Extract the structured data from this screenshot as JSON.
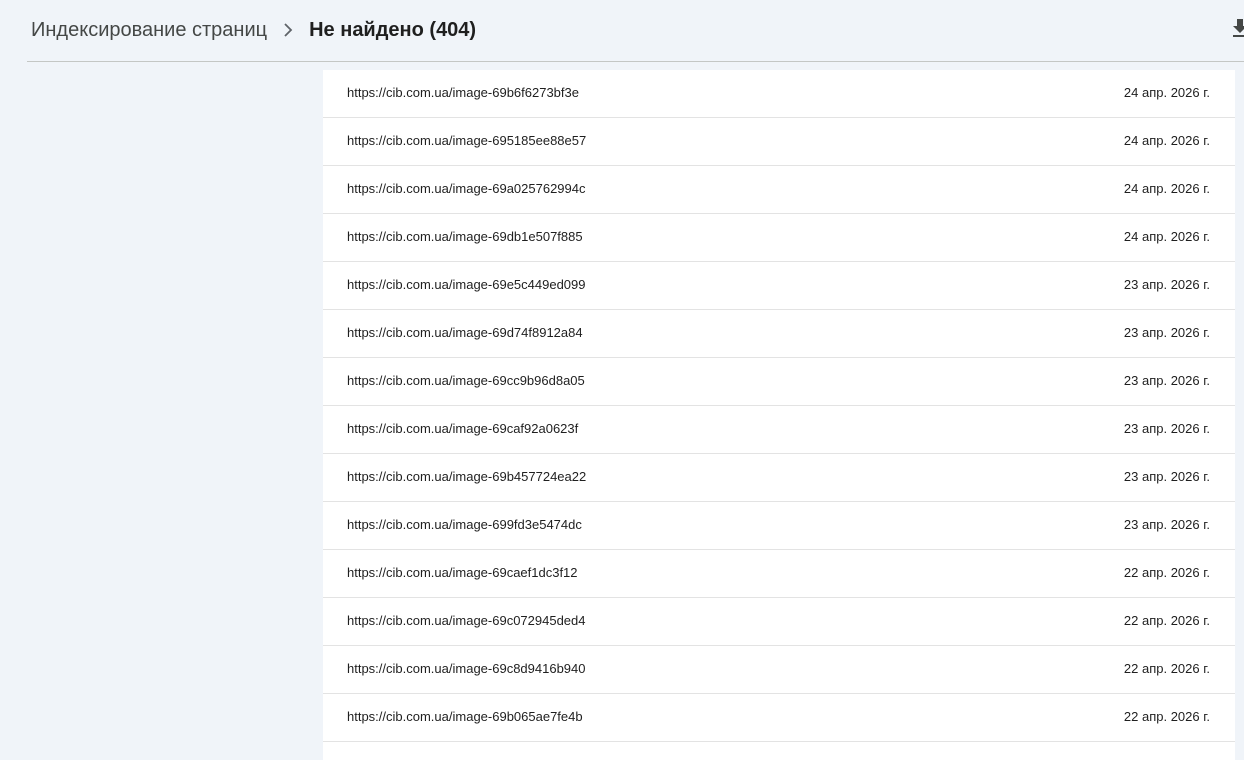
{
  "header": {
    "breadcrumb_parent": "Индексирование страниц",
    "breadcrumb_current": "Не найдено (404)"
  },
  "icons": {
    "separator": "chevron-right-icon",
    "download": "download-icon"
  },
  "colors": {
    "background": "#f0f4f9",
    "table_background": "#ffffff",
    "divider": "#c4c7c5",
    "text": "#1f1f1f"
  },
  "table": {
    "rows": [
      {
        "url": "https://cib.com.ua/image-69b6f6273bf3e",
        "date": "24 апр. 2026 г."
      },
      {
        "url": "https://cib.com.ua/image-695185ee88e57",
        "date": "24 апр. 2026 г."
      },
      {
        "url": "https://cib.com.ua/image-69a025762994c",
        "date": "24 апр. 2026 г."
      },
      {
        "url": "https://cib.com.ua/image-69db1e507f885",
        "date": "24 апр. 2026 г."
      },
      {
        "url": "https://cib.com.ua/image-69e5c449ed099",
        "date": "23 апр. 2026 г."
      },
      {
        "url": "https://cib.com.ua/image-69d74f8912a84",
        "date": "23 апр. 2026 г."
      },
      {
        "url": "https://cib.com.ua/image-69cc9b96d8a05",
        "date": "23 апр. 2026 г."
      },
      {
        "url": "https://cib.com.ua/image-69caf92a0623f",
        "date": "23 апр. 2026 г."
      },
      {
        "url": "https://cib.com.ua/image-69b457724ea22",
        "date": "23 апр. 2026 г."
      },
      {
        "url": "https://cib.com.ua/image-699fd3e5474dc",
        "date": "23 апр. 2026 г."
      },
      {
        "url": "https://cib.com.ua/image-69caef1dc3f12",
        "date": "22 апр. 2026 г."
      },
      {
        "url": "https://cib.com.ua/image-69c072945ded4",
        "date": "22 апр. 2026 г."
      },
      {
        "url": "https://cib.com.ua/image-69c8d9416b940",
        "date": "22 апр. 2026 г."
      },
      {
        "url": "https://cib.com.ua/image-69b065ae7fe4b",
        "date": "22 апр. 2026 г."
      }
    ]
  }
}
